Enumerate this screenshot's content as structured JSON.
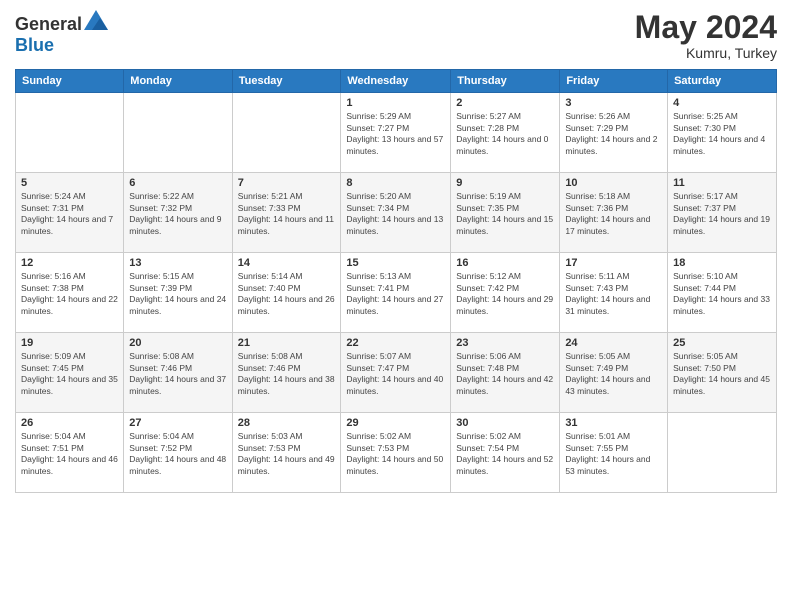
{
  "header": {
    "logo_general": "General",
    "logo_blue": "Blue",
    "month_year": "May 2024",
    "location": "Kumru, Turkey"
  },
  "days_of_week": [
    "Sunday",
    "Monday",
    "Tuesday",
    "Wednesday",
    "Thursday",
    "Friday",
    "Saturday"
  ],
  "weeks": [
    [
      {
        "day": "",
        "info": ""
      },
      {
        "day": "",
        "info": ""
      },
      {
        "day": "",
        "info": ""
      },
      {
        "day": "1",
        "info": "Sunrise: 5:29 AM\nSunset: 7:27 PM\nDaylight: 13 hours and 57 minutes."
      },
      {
        "day": "2",
        "info": "Sunrise: 5:27 AM\nSunset: 7:28 PM\nDaylight: 14 hours and 0 minutes."
      },
      {
        "day": "3",
        "info": "Sunrise: 5:26 AM\nSunset: 7:29 PM\nDaylight: 14 hours and 2 minutes."
      },
      {
        "day": "4",
        "info": "Sunrise: 5:25 AM\nSunset: 7:30 PM\nDaylight: 14 hours and 4 minutes."
      }
    ],
    [
      {
        "day": "5",
        "info": "Sunrise: 5:24 AM\nSunset: 7:31 PM\nDaylight: 14 hours and 7 minutes."
      },
      {
        "day": "6",
        "info": "Sunrise: 5:22 AM\nSunset: 7:32 PM\nDaylight: 14 hours and 9 minutes."
      },
      {
        "day": "7",
        "info": "Sunrise: 5:21 AM\nSunset: 7:33 PM\nDaylight: 14 hours and 11 minutes."
      },
      {
        "day": "8",
        "info": "Sunrise: 5:20 AM\nSunset: 7:34 PM\nDaylight: 14 hours and 13 minutes."
      },
      {
        "day": "9",
        "info": "Sunrise: 5:19 AM\nSunset: 7:35 PM\nDaylight: 14 hours and 15 minutes."
      },
      {
        "day": "10",
        "info": "Sunrise: 5:18 AM\nSunset: 7:36 PM\nDaylight: 14 hours and 17 minutes."
      },
      {
        "day": "11",
        "info": "Sunrise: 5:17 AM\nSunset: 7:37 PM\nDaylight: 14 hours and 19 minutes."
      }
    ],
    [
      {
        "day": "12",
        "info": "Sunrise: 5:16 AM\nSunset: 7:38 PM\nDaylight: 14 hours and 22 minutes."
      },
      {
        "day": "13",
        "info": "Sunrise: 5:15 AM\nSunset: 7:39 PM\nDaylight: 14 hours and 24 minutes."
      },
      {
        "day": "14",
        "info": "Sunrise: 5:14 AM\nSunset: 7:40 PM\nDaylight: 14 hours and 26 minutes."
      },
      {
        "day": "15",
        "info": "Sunrise: 5:13 AM\nSunset: 7:41 PM\nDaylight: 14 hours and 27 minutes."
      },
      {
        "day": "16",
        "info": "Sunrise: 5:12 AM\nSunset: 7:42 PM\nDaylight: 14 hours and 29 minutes."
      },
      {
        "day": "17",
        "info": "Sunrise: 5:11 AM\nSunset: 7:43 PM\nDaylight: 14 hours and 31 minutes."
      },
      {
        "day": "18",
        "info": "Sunrise: 5:10 AM\nSunset: 7:44 PM\nDaylight: 14 hours and 33 minutes."
      }
    ],
    [
      {
        "day": "19",
        "info": "Sunrise: 5:09 AM\nSunset: 7:45 PM\nDaylight: 14 hours and 35 minutes."
      },
      {
        "day": "20",
        "info": "Sunrise: 5:08 AM\nSunset: 7:46 PM\nDaylight: 14 hours and 37 minutes."
      },
      {
        "day": "21",
        "info": "Sunrise: 5:08 AM\nSunset: 7:46 PM\nDaylight: 14 hours and 38 minutes."
      },
      {
        "day": "22",
        "info": "Sunrise: 5:07 AM\nSunset: 7:47 PM\nDaylight: 14 hours and 40 minutes."
      },
      {
        "day": "23",
        "info": "Sunrise: 5:06 AM\nSunset: 7:48 PM\nDaylight: 14 hours and 42 minutes."
      },
      {
        "day": "24",
        "info": "Sunrise: 5:05 AM\nSunset: 7:49 PM\nDaylight: 14 hours and 43 minutes."
      },
      {
        "day": "25",
        "info": "Sunrise: 5:05 AM\nSunset: 7:50 PM\nDaylight: 14 hours and 45 minutes."
      }
    ],
    [
      {
        "day": "26",
        "info": "Sunrise: 5:04 AM\nSunset: 7:51 PM\nDaylight: 14 hours and 46 minutes."
      },
      {
        "day": "27",
        "info": "Sunrise: 5:04 AM\nSunset: 7:52 PM\nDaylight: 14 hours and 48 minutes."
      },
      {
        "day": "28",
        "info": "Sunrise: 5:03 AM\nSunset: 7:53 PM\nDaylight: 14 hours and 49 minutes."
      },
      {
        "day": "29",
        "info": "Sunrise: 5:02 AM\nSunset: 7:53 PM\nDaylight: 14 hours and 50 minutes."
      },
      {
        "day": "30",
        "info": "Sunrise: 5:02 AM\nSunset: 7:54 PM\nDaylight: 14 hours and 52 minutes."
      },
      {
        "day": "31",
        "info": "Sunrise: 5:01 AM\nSunset: 7:55 PM\nDaylight: 14 hours and 53 minutes."
      },
      {
        "day": "",
        "info": ""
      }
    ]
  ]
}
